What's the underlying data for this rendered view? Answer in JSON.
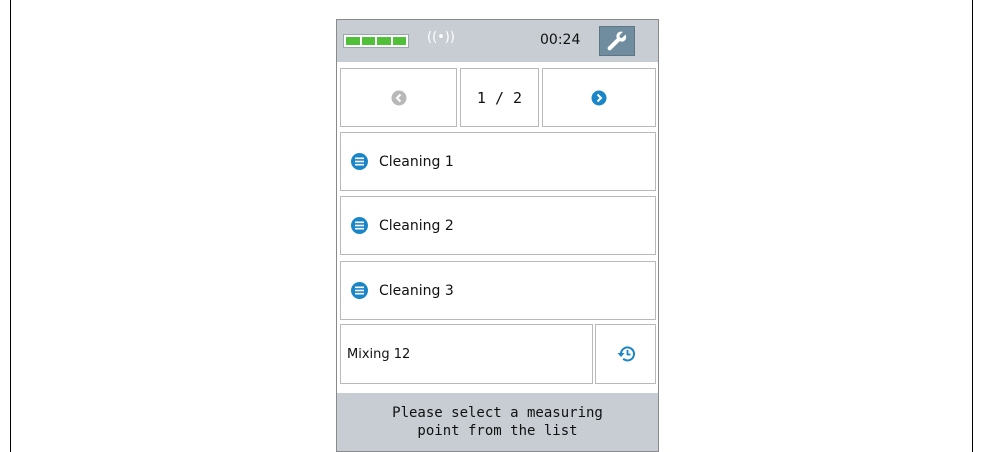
{
  "status": {
    "battery_level": "4/4",
    "signal_icon": "wireless-signal-icon",
    "signal_text": "((•))",
    "time": "00:24",
    "settings_icon": "wrench-icon"
  },
  "pager": {
    "prev_icon": "arrow-left-circle-icon",
    "prev_enabled": false,
    "page_indicator": "1 / 2",
    "next_icon": "arrow-right-circle-icon",
    "next_enabled": true
  },
  "items": [
    {
      "label": "Cleaning 1",
      "icon": "list-icon"
    },
    {
      "label": "Cleaning 2",
      "icon": "list-icon"
    },
    {
      "label": "Cleaning 3",
      "icon": "list-icon"
    }
  ],
  "last_row": {
    "label": "Mixing 12",
    "icon": "history-icon"
  },
  "footer": {
    "message": "Please select a measuring\npoint from the list"
  },
  "colors": {
    "accent_blue": "#1a86c8",
    "battery_green": "#4fc037",
    "bar_gray": "#c7cdd3",
    "wrench_bg": "#6f8d9f"
  }
}
